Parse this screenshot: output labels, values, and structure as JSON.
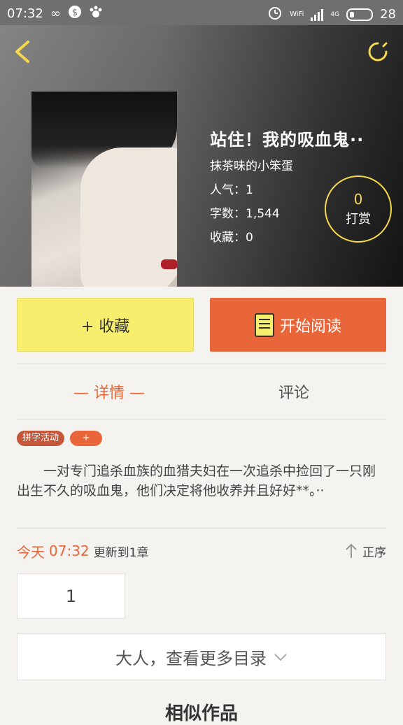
{
  "status_bar": {
    "time": "07:32",
    "battery": "28",
    "net": "4G",
    "wifi": "WiFi"
  },
  "book": {
    "title": "站住！我的吸血鬼··",
    "author": "抹茶味的小笨蛋",
    "popularity": "人气：1",
    "word_count": "字数：1,544",
    "favorites": "收藏：0",
    "tip_count": "0",
    "tip_label": "打赏"
  },
  "actions": {
    "favorite_label": "+ 收藏",
    "read_label": "开始阅读"
  },
  "tabs": [
    {
      "label": "— 详情 —"
    },
    {
      "label": "评论"
    }
  ],
  "tags": [
    {
      "label": "拼字活动"
    },
    {
      "label": "+"
    }
  ],
  "description": "一对专门追杀血族的血猎夫妇在一次追杀中捡回了一只刚出生不久的吸血鬼，他们决定将他收养并且好好**。··",
  "update": {
    "day": "今天",
    "time": "07:32",
    "text": "更新到1章",
    "order_label": "正序"
  },
  "chapters": [
    {
      "label": "1"
    }
  ],
  "more_catalog": "大人，查看更多目录",
  "similar_title": "相似作品",
  "colors": {
    "accent": "#e8663a",
    "yellow": "#f8ee6e",
    "gold": "#f4d84a"
  }
}
